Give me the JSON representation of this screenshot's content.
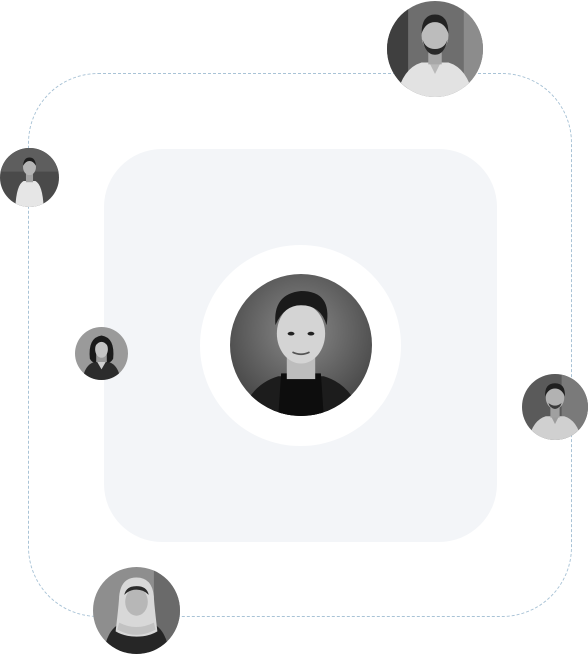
{
  "palette": {
    "background": "#ffffff",
    "card": "#f3f5f8",
    "ring": "#ffffff",
    "dashed_border": "#a9c3d6"
  },
  "avatars": [
    {
      "role": "center",
      "icon": "man-turtleneck-portrait"
    },
    {
      "role": "orbit",
      "icon": "man-beard-shirt-portrait"
    },
    {
      "role": "orbit",
      "icon": "man-standing-portrait"
    },
    {
      "role": "orbit",
      "icon": "woman-portrait"
    },
    {
      "role": "orbit",
      "icon": "man-shirt-portrait"
    },
    {
      "role": "orbit",
      "icon": "woman-headscarf-portrait"
    }
  ]
}
